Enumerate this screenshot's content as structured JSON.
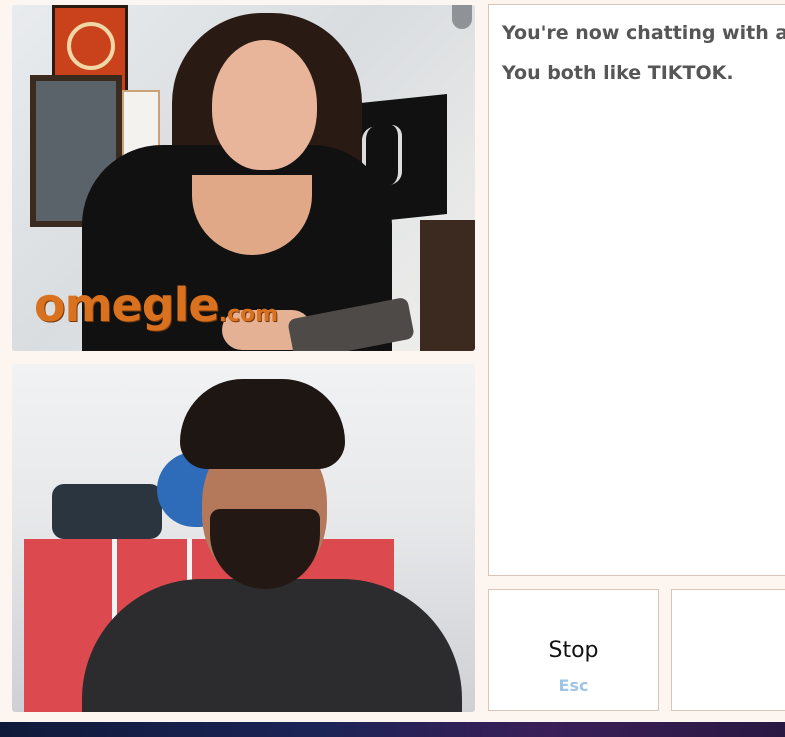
{
  "stranger_video": {
    "watermark_main": "omegle",
    "watermark_suffix": ".com"
  },
  "chat": {
    "status_lines": [
      "You're now chatting with a random stranger. Say hi!",
      "You both like TIKTOK."
    ]
  },
  "controls": {
    "stop_label": "Stop",
    "stop_key": "Esc"
  },
  "colors": {
    "watermark": "#d9711e",
    "key_hint": "#9fc4e6",
    "background": "#fdf5ef"
  }
}
